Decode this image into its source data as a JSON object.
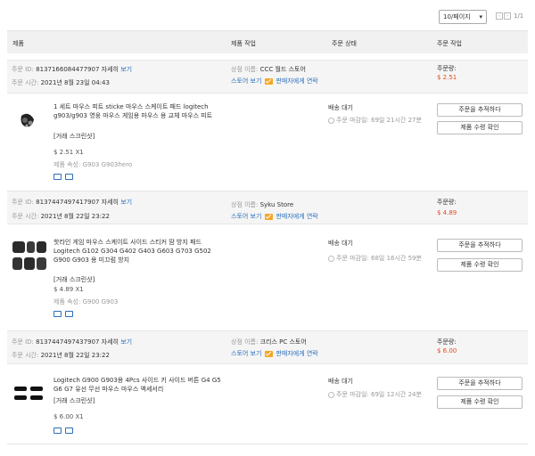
{
  "pagination": {
    "per_page": "10/페이지",
    "page": "1/1"
  },
  "table_header": {
    "product": "제품",
    "product_action": "제품 작업",
    "order_status": "주문 상태",
    "order_action": "주문 작업"
  },
  "labels": {
    "order_id": "주문 ID:",
    "order_time": "주문 시간:",
    "detail": "자세히",
    "view": "보기",
    "store_name": "상점 이름:",
    "store_view": "스토어 보기",
    "contact_seller": "판매자에게 연락",
    "order_amount": "주문량:",
    "screenshot": "[거래 스크린샷]",
    "attr_prefix": "제품 속성:",
    "track_order": "주문을 추적하다",
    "confirm_receipt": "제품 수령 확인"
  },
  "orders": [
    {
      "id": "8137166084477907",
      "time": "2021년 8월 23일 04:43",
      "store": "CCC 월드 스토어",
      "amount": "$ 2.51",
      "product": "1 세트 마우스 피트 sticke 마우스 스케이트 패드 logitech g903/g903 영웅 마우스 게임용 마우스 용 교체 마우스 피트",
      "price": "$ 2.51 X1",
      "attr": "G903 G903hero",
      "status": "배송 대기",
      "deadline": "주문 마감일: 69일 21시간 27분"
    },
    {
      "id": "8137447497417907",
      "time": "2021년 8월 22일 23:22",
      "store": "Syku Store",
      "amount": "$ 4.89",
      "product": "핫라인 게임 마우스 스케이트 사이드 스티커 땀 방지 패드 Logitech G102 G304 G402 G403 G603 G703 G502 G900 G903 용 미끄럼 방지",
      "price": "$ 4.89 X1",
      "attr": "G900 G903",
      "status": "배송 대기",
      "deadline": "주문 마감일: 68일 16시간 59분"
    },
    {
      "id": "8137447497437907",
      "time": "2021년 8월 22일 23:22",
      "store": "크리스 PC 스토어",
      "amount": "$ 6.00",
      "product": "Logitech G900 G903용 4Pcs 사이드 키 사이드 버튼 G4 G5 G6 G7 유선 무선 마우스 마우스 액세서리",
      "price": "$ 6.00 X1",
      "attr": "",
      "status": "배송 대기",
      "deadline": "주문 마감일: 69일 12시간 24분"
    }
  ],
  "colors": {
    "link": "#2a6fbd",
    "price_accent": "#e64a19",
    "mail_icon": "#f5a623",
    "header_bg": "#f1f1f1"
  }
}
